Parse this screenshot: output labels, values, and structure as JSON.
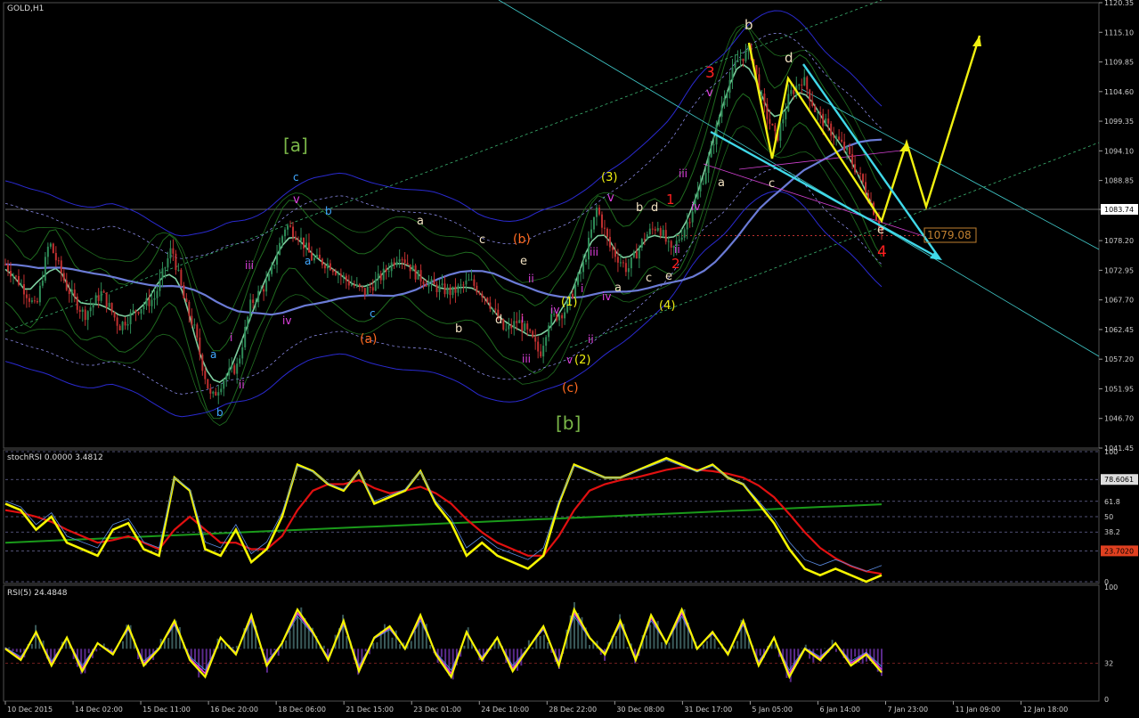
{
  "window_title": "GOLD,H1",
  "colors": {
    "background": "#000000",
    "grid": "#3a3a3a",
    "price_bull": "#2e8b57",
    "price_bear": "#c03030",
    "ma_blue": "#6b7bd6",
    "ma_green": "#7fd0a0",
    "band_green": "#1f6b1f",
    "band_blue": "#2a2ad0",
    "elliott_yellow": "#f0f010",
    "elliott_cyan": "#40d8e8",
    "stochrsi_yellow": "#f5f500",
    "stochrsi_red": "#e01010",
    "rsi_magenta": "#e040e0"
  },
  "chart_data": [
    {
      "type": "line",
      "name": "main-price",
      "title": "GOLD,H1",
      "x_tick_labels": [
        "10 Dec 2015",
        "14 Dec 02:00",
        "15 Dec 11:00",
        "16 Dec 20:00",
        "18 Dec 06:00",
        "21 Dec 15:00",
        "23 Dec 01:00",
        "24 Dec 10:00",
        "28 Dec 22:00",
        "30 Dec 08:00",
        "31 Dec 17:00",
        "5 Jan 05:00",
        "6 Jan 14:00",
        "7 Jan 23:00",
        "11 Jan 09:00",
        "12 Jan 18:00"
      ],
      "y_tick_labels": [
        "1120.35",
        "1115.10",
        "1109.85",
        "1104.60",
        "1099.35",
        "1094.10",
        "1088.85",
        "1083.74",
        "1078.20",
        "1072.95",
        "1067.70",
        "1062.45",
        "1057.20",
        "1051.95",
        "1046.70",
        "1041.45"
      ],
      "ylim": [
        1041.45,
        1120.35
      ],
      "current_price_label": "1083.74",
      "price_tag": "1079.08",
      "x": [
        0,
        0.02,
        0.035,
        0.05,
        0.07,
        0.09,
        0.11,
        0.13,
        0.15,
        0.17,
        0.19,
        0.205,
        0.215,
        0.225,
        0.235,
        0.25,
        0.265,
        0.28,
        0.3,
        0.32,
        0.335,
        0.35,
        0.37,
        0.39,
        0.41,
        0.43,
        0.45,
        0.47,
        0.49,
        0.51,
        0.53,
        0.55,
        0.57,
        0.585,
        0.6,
        0.61,
        0.62,
        0.64,
        0.66,
        0.675,
        0.69,
        0.71,
        0.73,
        0.745,
        0.76,
        0.78,
        0.8,
        0.81,
        0.82,
        0.835,
        0.85,
        0.865,
        0.88,
        0.895,
        0.91,
        0.925,
        0.94,
        0.96,
        0.98,
        1.0
      ],
      "values": [
        1074,
        1070,
        1066,
        1078,
        1070,
        1065,
        1069,
        1063,
        1066,
        1068,
        1077,
        1067,
        1063,
        1056,
        1050,
        1054,
        1056,
        1067,
        1071,
        1081,
        1079,
        1075,
        1074,
        1071,
        1069,
        1072,
        1076,
        1072,
        1070,
        1069,
        1071,
        1068,
        1062,
        1064,
        1061,
        1058,
        1064,
        1066,
        1074,
        1084,
        1077,
        1073,
        1079,
        1081,
        1076,
        1082,
        1091,
        1097,
        1104,
        1110,
        1112,
        1102,
        1096,
        1104,
        1107,
        1101,
        1098,
        1094,
        1088,
        1080
      ],
      "series_overlays": [
        "moving averages",
        "envelope bands",
        "Elliott wave labels",
        "projection arrows"
      ],
      "wave_labels": [
        "[a]",
        "[b]",
        "(a)",
        "(b)",
        "(c)",
        "(1)",
        "(2)",
        "(3)",
        "(4)",
        "a",
        "b",
        "c",
        "d",
        "e",
        "i",
        "ii",
        "iii",
        "iv",
        "v",
        "1",
        "2",
        "3",
        "4"
      ]
    },
    {
      "type": "line",
      "name": "stochRSI",
      "title": "stochRSI 0.0000 3.4812",
      "ylim": [
        0,
        100
      ],
      "levels": [
        100,
        78.6061,
        61.8,
        50,
        38.2,
        23.702,
        0
      ],
      "level_labels": [
        "100",
        "78.6061",
        "61.8",
        "50",
        "38.2",
        "23.7020",
        "0"
      ],
      "values": [
        60,
        55,
        40,
        50,
        30,
        25,
        20,
        40,
        45,
        25,
        20,
        80,
        70,
        25,
        20,
        40,
        15,
        25,
        50,
        90,
        85,
        75,
        70,
        85,
        60,
        65,
        70,
        85,
        60,
        45,
        20,
        30,
        20,
        15,
        10,
        20,
        60,
        90,
        85,
        80,
        80,
        85,
        90,
        95,
        90,
        85,
        90,
        80,
        75,
        60,
        45,
        25,
        10,
        5,
        10,
        5,
        0,
        5
      ],
      "signal_values": [
        55,
        53,
        50,
        46,
        40,
        35,
        30,
        32,
        35,
        30,
        25,
        40,
        50,
        40,
        30,
        30,
        25,
        25,
        35,
        55,
        70,
        75,
        75,
        78,
        72,
        68,
        70,
        73,
        68,
        60,
        48,
        38,
        30,
        25,
        20,
        20,
        35,
        55,
        70,
        75,
        78,
        80,
        83,
        86,
        88,
        86,
        85,
        83,
        80,
        74,
        65,
        52,
        38,
        26,
        18,
        12,
        8,
        6
      ]
    },
    {
      "type": "line",
      "name": "RSI",
      "title": "RSI(5) 24.4848",
      "ylim": [
        0,
        100
      ],
      "levels": [
        100,
        32,
        0
      ],
      "level_labels": [
        "100",
        "32",
        "0"
      ],
      "values": [
        45,
        35,
        60,
        30,
        55,
        25,
        50,
        40,
        65,
        30,
        45,
        70,
        35,
        20,
        55,
        40,
        75,
        30,
        50,
        80,
        60,
        35,
        70,
        25,
        55,
        65,
        45,
        75,
        40,
        20,
        60,
        35,
        55,
        25,
        45,
        65,
        30,
        80,
        55,
        40,
        70,
        35,
        75,
        50,
        80,
        45,
        60,
        40,
        70,
        30,
        55,
        20,
        45,
        35,
        50,
        30,
        40,
        24
      ]
    }
  ]
}
